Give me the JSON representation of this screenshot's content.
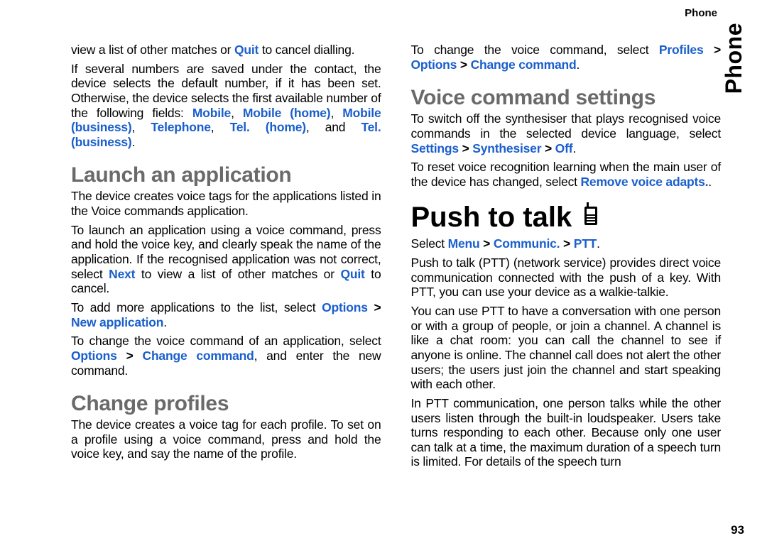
{
  "header_section": "Phone",
  "side_tab": "Phone",
  "page_number": "93",
  "col1": {
    "p1_a": "view a list of other matches or ",
    "p1_quit": "Quit",
    "p1_b": " to cancel dialling.",
    "p2_a": "If several numbers are saved under the contact, the device selects the default number, if it has been set. Otherwise, the device selects the first available number of the following fields: ",
    "p2_mobile": "Mobile",
    "p2_comma1": ", ",
    "p2_mobilehome": "Mobile (home)",
    "p2_comma2": ", ",
    "p2_mobilebiz": "Mobile (business)",
    "p2_comma3": ", ",
    "p2_telephone": "Telephone",
    "p2_comma4": ", ",
    "p2_telhome": "Tel. (home)",
    "p2_and": ", and ",
    "p2_telbiz": "Tel. (business)",
    "p2_period": ".",
    "h2_launch": "Launch an application",
    "p3": "The device creates voice tags for the applications listed in the Voice commands application.",
    "p4_a": "To launch an application using a voice command, press and hold the voice key, and clearly speak the name of the application. If the recognised application was not correct, select ",
    "p4_next": "Next",
    "p4_b": " to view a list of other matches or ",
    "p4_quit": "Quit",
    "p4_c": " to cancel.",
    "p5_a": "To add more applications to the list, select ",
    "p5_options": "Options",
    "p5_gt1": " > ",
    "p5_newapp": "New application",
    "p5_period": ".",
    "p6_a": "To change the voice command of an application, select ",
    "p6_options": "Options",
    "p6_gt1": " > ",
    "p6_changecmd": "Change command",
    "p6_b": ", and enter the new command.",
    "h2_change": "Change profiles",
    "p7": "The device creates a voice tag for each profile. To set on a profile using a voice command, press and hold the voice key, and say the name of the profile."
  },
  "col2": {
    "p8_a": "To change the voice command, select ",
    "p8_profiles": "Profiles",
    "p8_gt1": " > ",
    "p8_options": "Options",
    "p8_gt2": " > ",
    "p8_changecmd": "Change command",
    "p8_period": ".",
    "h2_voice": "Voice command settings",
    "p9_a": "To switch off the synthesiser that plays recognised voice commands in the selected device language, select ",
    "p9_settings": "Settings",
    "p9_gt1": " > ",
    "p9_synth": "Synthesiser",
    "p9_gt2": " > ",
    "p9_off": "Off",
    "p9_period": ".",
    "p10_a": "To reset voice recognition learning when the main user of the device has changed, select ",
    "p10_remove": "Remove voice adapts.",
    "p10_period": ".",
    "h1_ptt": "Push to talk",
    "p11_a": "Select ",
    "p11_menu": "Menu",
    "p11_gt1": " > ",
    "p11_comm": "Communic.",
    "p11_gt2": " > ",
    "p11_ptt": "PTT",
    "p11_period": ".",
    "p12": "Push to talk (PTT) (network service) provides direct voice communication connected with the push of a key. With PTT, you can use your device as a walkie-talkie.",
    "p13": "You can use PTT to have a conversation with one person or with a group of people, or join a channel. A channel is like a chat room: you can call the channel to see if anyone is online. The channel call does not alert the other users; the users just join the channel and start speaking with each other.",
    "p14": "In PTT communication, one person talks while the other users listen through the built-in loudspeaker. Users take turns responding to each other. Because only one user can talk at a time, the maximum duration of a speech turn is limited. For details of the speech turn"
  }
}
